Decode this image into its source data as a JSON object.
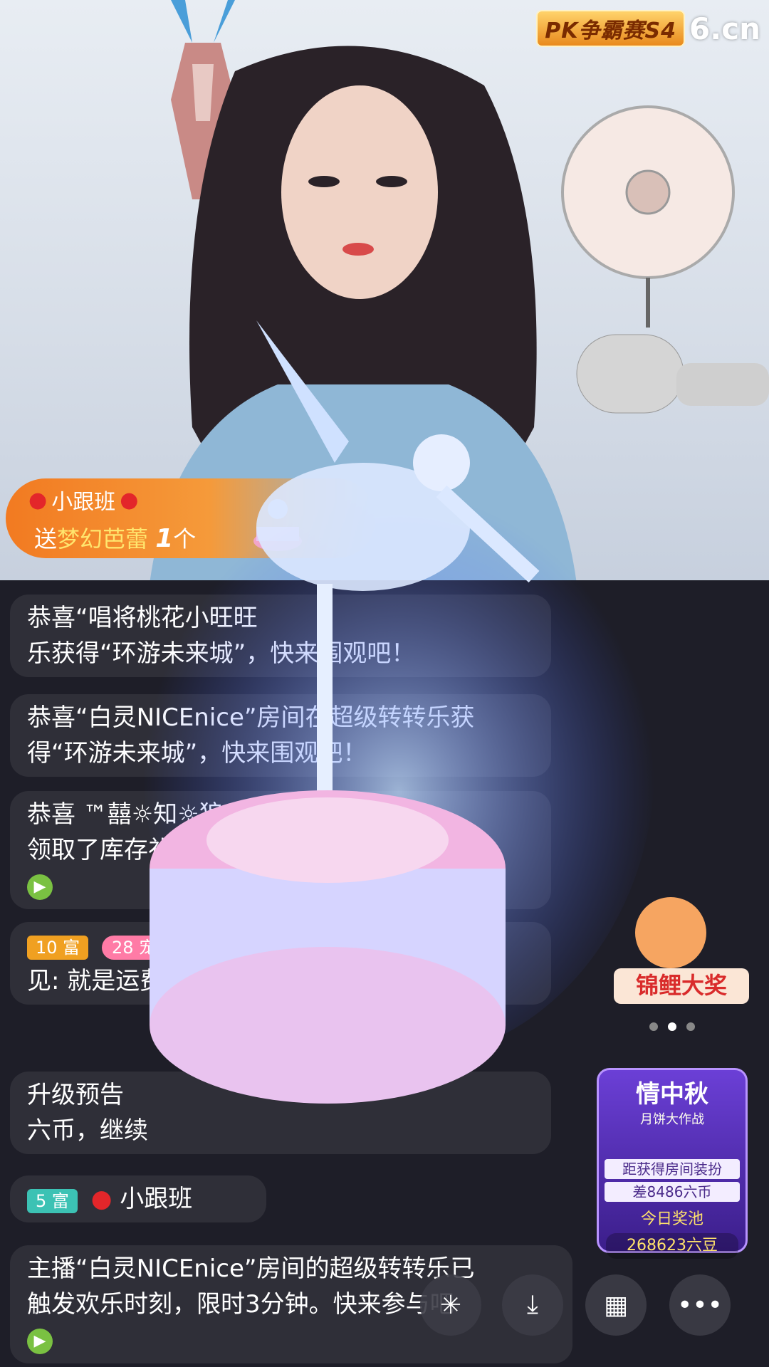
{
  "header": {
    "pk_badge": "PK争霸赛S4",
    "site_logo": "6.cn"
  },
  "gift_banner": {
    "user": "小跟班",
    "prefix": "送",
    "gift_name": "梦幻芭蕾",
    "count": "1",
    "unit": "个"
  },
  "chat": {
    "messages": [
      {
        "text_line1": "恭喜“唱将桃花小旺旺",
        "text_line2": "乐获得“环游未来城”，快来围观吧！"
      },
      {
        "text_line1": "恭喜“白灵NICEnice”房间在超级转转乐获",
        "text_line2": "得“环游未来城”，快来围观吧！"
      },
      {
        "text_line1": "恭喜 ™囍☼知☼狼",
        "text_line2": "领取了库存礼物30个"
      },
      {
        "level": "10 富",
        "pet_tag": "28 宠梦儿",
        "text": "见: 就是运费"
      },
      {
        "text_line1": "升级预告",
        "text_line2": "六币，继续"
      },
      {
        "level": "5 富",
        "user": "小跟班"
      },
      {
        "text_line1": "主播“白灵NICEnice”房间的超级转转乐已",
        "text_line2": "触发欢乐时刻，限时3分钟。快来参与吧"
      }
    ]
  },
  "side_banners": {
    "koi": "锦鲤大奖",
    "mid_autumn_title": "情中秋",
    "mid_autumn_sub": "月饼大作战",
    "progress_label": "距获得房间装扮",
    "progress_value": "差8486六币",
    "pool_label": "今日奖池",
    "pool_total": "268623六豆"
  },
  "colors": {
    "gift_orange": "#f27a21",
    "gift_name_yellow": "#ffe66e",
    "level_orange": "#f0a021",
    "level_teal": "#3cc2b4",
    "go_green": "#7ac142"
  },
  "controls": {
    "icons": [
      "sparkle-icon",
      "download-icon",
      "grid-icon",
      "more-icon"
    ]
  }
}
